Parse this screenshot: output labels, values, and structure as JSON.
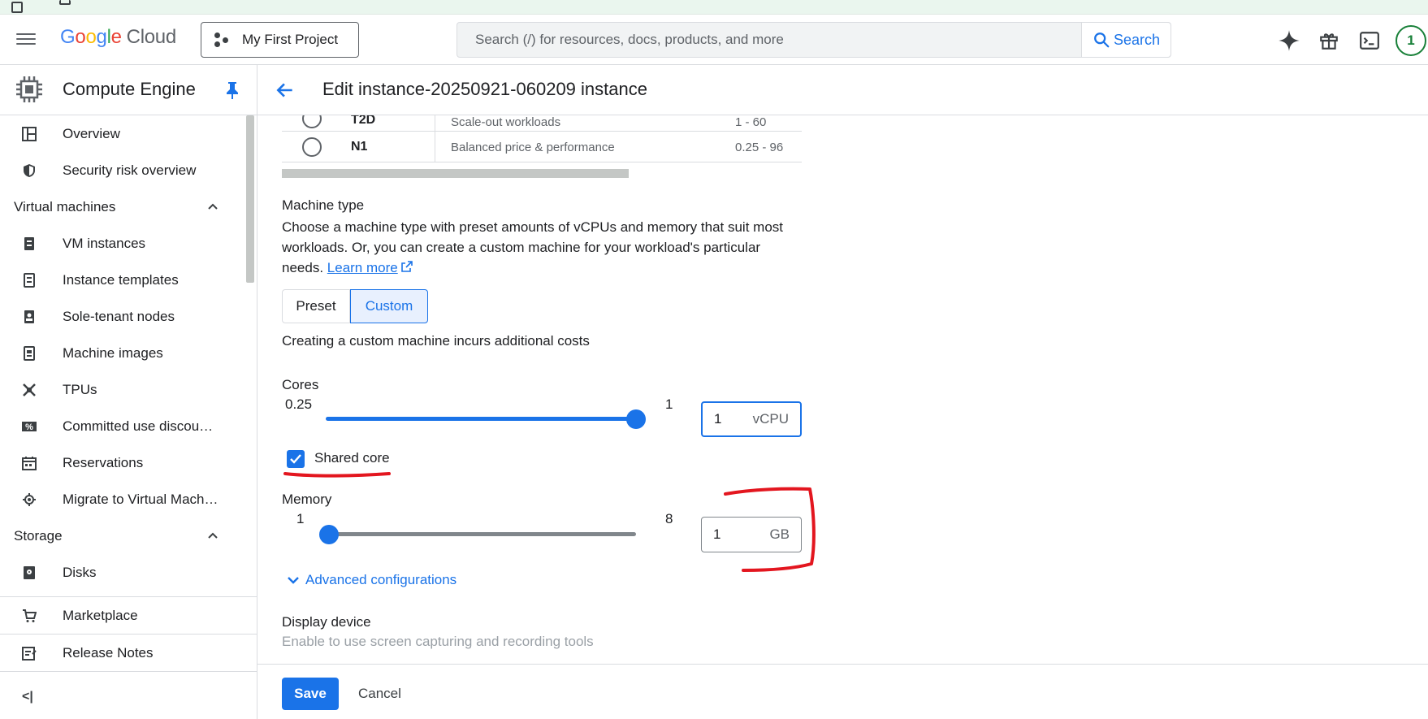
{
  "header": {
    "logo_google": "Google",
    "logo_cloud": "Cloud",
    "project": "My First Project",
    "search_placeholder": "Search (/) for resources, docs, products, and more",
    "search_button": "Search",
    "avatar_initial": "1"
  },
  "sidebar": {
    "product": "Compute Engine",
    "items": [
      {
        "label": "Overview",
        "icon": "dashboard-icon"
      },
      {
        "label": "Security risk overview",
        "icon": "shield-icon"
      }
    ],
    "section_vm": "Virtual machines",
    "vm_items": [
      {
        "label": "VM instances",
        "icon": "vm-icon"
      },
      {
        "label": "Instance templates",
        "icon": "template-icon"
      },
      {
        "label": "Sole-tenant nodes",
        "icon": "node-icon"
      },
      {
        "label": "Machine images",
        "icon": "image-icon"
      },
      {
        "label": "TPUs",
        "icon": "tpu-icon"
      },
      {
        "label": "Committed use discou…",
        "icon": "percent-icon"
      },
      {
        "label": "Reservations",
        "icon": "calendar-icon"
      },
      {
        "label": "Migrate to Virtual Mach…",
        "icon": "migrate-icon"
      }
    ],
    "section_storage": "Storage",
    "storage_items": [
      {
        "label": "Disks",
        "icon": "disk-icon"
      }
    ],
    "marketplace": "Marketplace",
    "release_notes": "Release Notes",
    "collapse": "<|"
  },
  "main": {
    "title": "Edit instance-20250921-060209 instance",
    "series_rows": [
      {
        "name": "T2D",
        "desc": "Scale-out workloads",
        "vcpus": "1 - 60"
      },
      {
        "name": "N1",
        "desc": "Balanced price & performance",
        "vcpus": "0.25 - 96"
      }
    ],
    "machine_type_label": "Machine type",
    "machine_type_desc": "Choose a machine type with preset amounts of vCPUs and memory that suit most workloads. Or, you can create a custom machine for your workload's particular needs.",
    "learn_more": "Learn more",
    "preset": "Preset",
    "custom": "Custom",
    "custom_note": "Creating a custom machine incurs additional costs",
    "cores_label": "Cores",
    "cores_min": "0.25",
    "cores_max": "1",
    "cores_value": "1",
    "cores_unit": "vCPU",
    "cores_slider_fraction": 1.0,
    "shared_core": "Shared core",
    "shared_core_checked": true,
    "memory_label": "Memory",
    "memory_min": "1",
    "memory_max": "8",
    "memory_value": "1",
    "memory_unit": "GB",
    "memory_slider_fraction": 0.0,
    "advanced": "Advanced configurations",
    "display_device": "Display device",
    "display_hint": "Enable to use screen capturing and recording tools"
  },
  "footer": {
    "save": "Save",
    "cancel": "Cancel"
  },
  "colors": {
    "accent": "#1a73e8",
    "annotation": "#e3161f"
  }
}
